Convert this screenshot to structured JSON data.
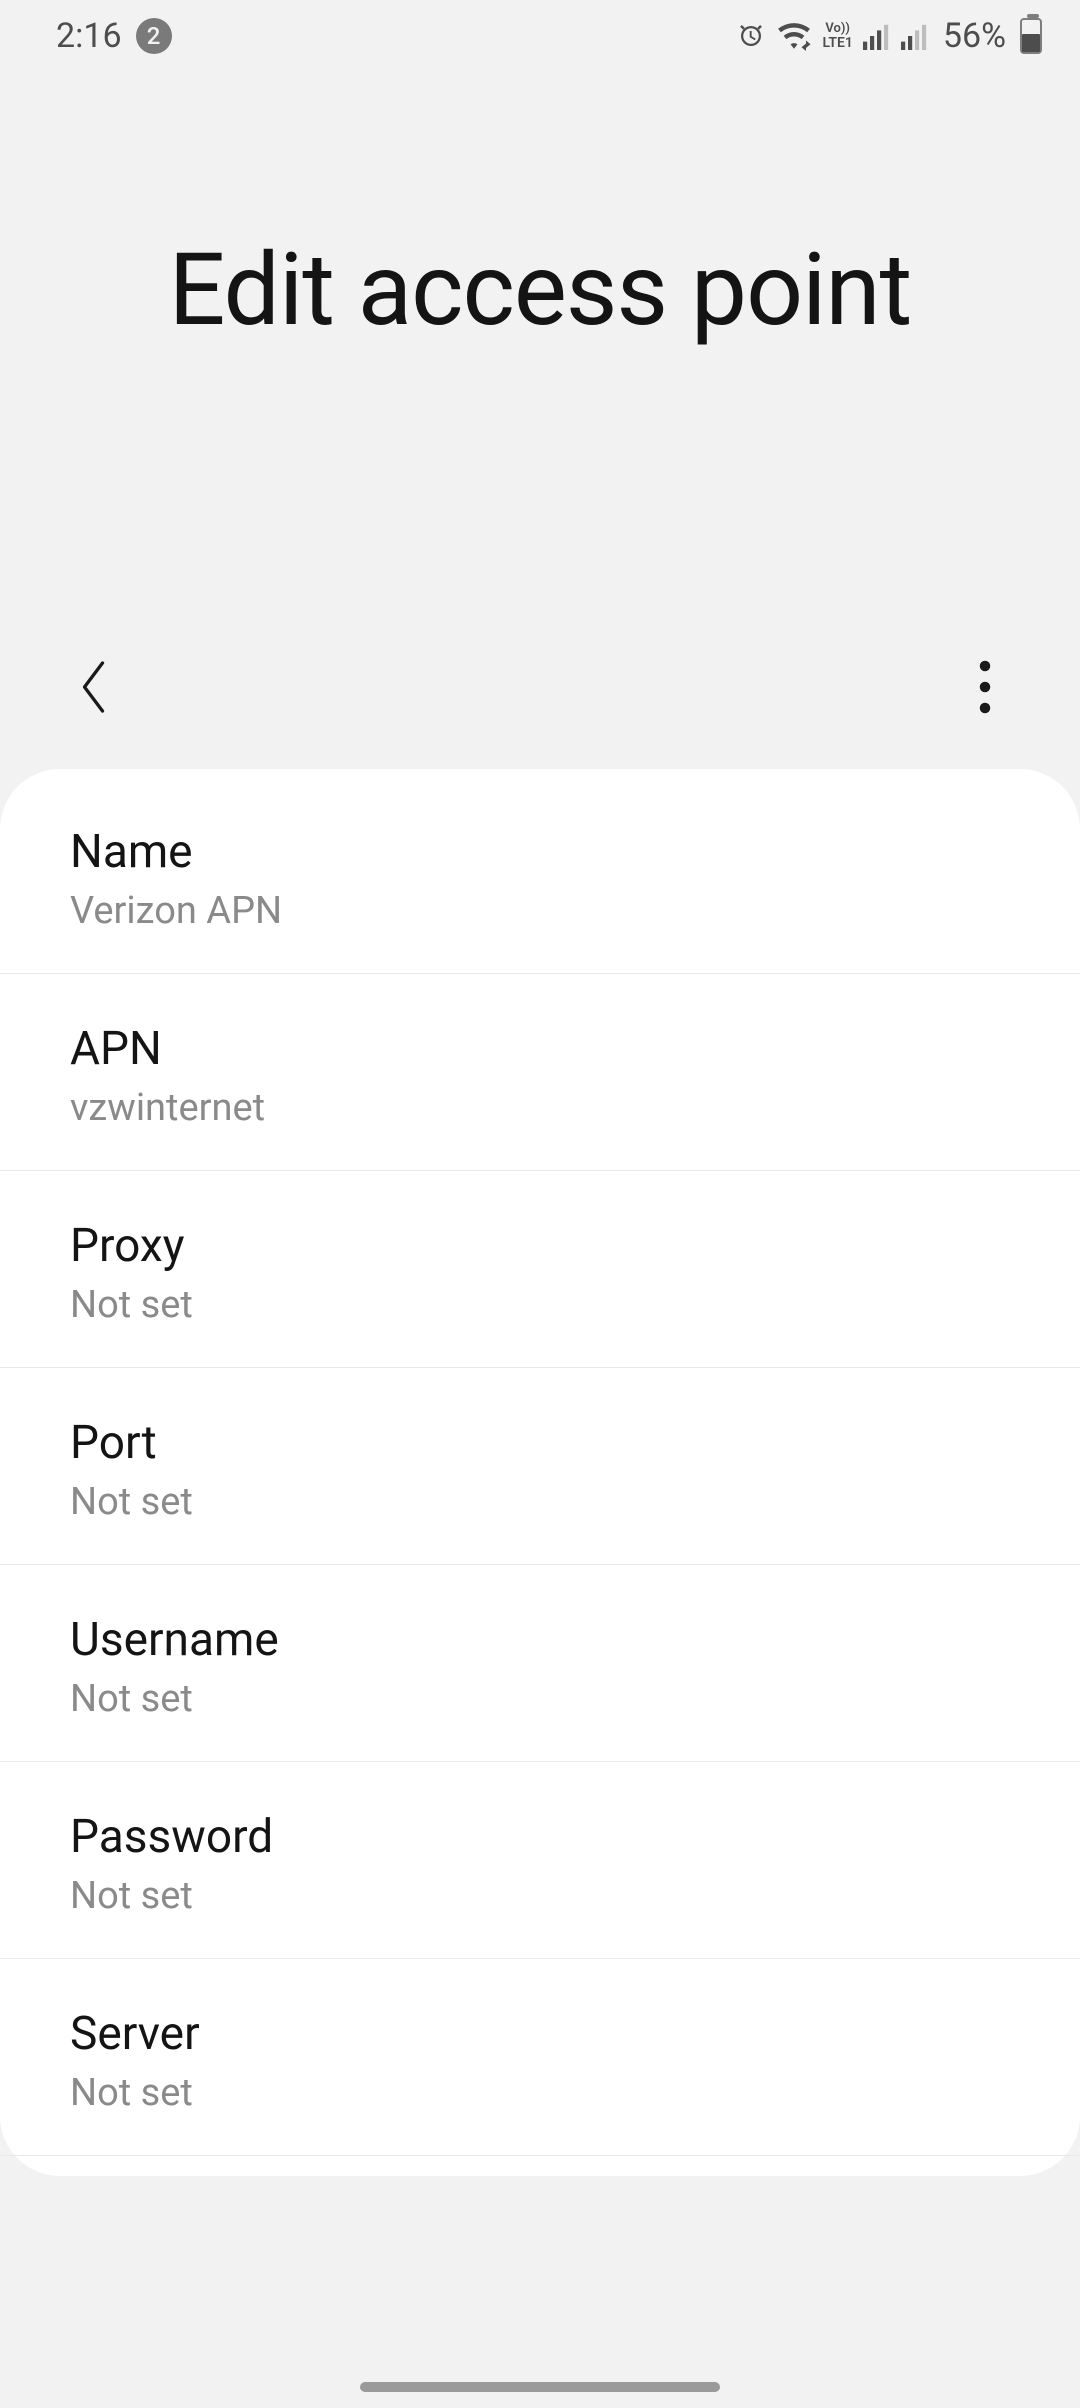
{
  "status": {
    "time": "2:16",
    "notif_count": "2",
    "battery_pct": "56%",
    "battery_level": 0.56,
    "lte": "LTE1",
    "vo": "Vo))"
  },
  "header": {
    "title": "Edit access point"
  },
  "items": [
    {
      "label": "Name",
      "value": "Verizon APN"
    },
    {
      "label": "APN",
      "value": "vzwinternet"
    },
    {
      "label": "Proxy",
      "value": "Not set"
    },
    {
      "label": "Port",
      "value": "Not set"
    },
    {
      "label": "Username",
      "value": "Not set"
    },
    {
      "label": "Password",
      "value": "Not set"
    },
    {
      "label": "Server",
      "value": "Not set"
    }
  ]
}
